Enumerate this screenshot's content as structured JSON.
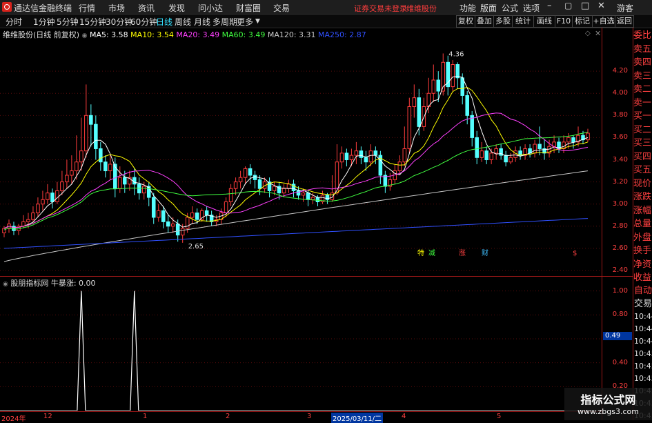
{
  "app": {
    "title": "通达信金融终端",
    "menu": [
      "行情",
      "市场",
      "资讯",
      "发现",
      "问小达",
      "财富圈",
      "交易"
    ],
    "status": "证券交易未登录",
    "stock": "维维股份",
    "right_menu": [
      "功能",
      "版面",
      "公式",
      "选项"
    ],
    "guest": "游客"
  },
  "toolbar": {
    "periods": [
      "分时",
      "1分钟",
      "5分钟",
      "15分钟",
      "30分钟",
      "60分钟",
      "日线",
      "周线",
      "月线",
      "多周期",
      "更多"
    ],
    "active": "日线",
    "buttons": [
      "复权",
      "叠加",
      "多股",
      "统计",
      "画线",
      "F10",
      "标记",
      "+自选",
      "返回"
    ]
  },
  "main_chart": {
    "name": "维维股份(日线 前复权)",
    "ma": [
      {
        "label": "MA5: 3.58",
        "color": "#ffffff"
      },
      {
        "label": "MA10: 3.54",
        "color": "#ffff00"
      },
      {
        "label": "MA20: 3.49",
        "color": "#ff40ff"
      },
      {
        "label": "MA60: 3.49",
        "color": "#40ff40"
      },
      {
        "label": "MA120: 3.31",
        "color": "#c8c8c8"
      },
      {
        "label": "MA250: 2.87",
        "color": "#3050ff"
      }
    ],
    "y_ticks": [
      "4.20",
      "4.00",
      "3.80",
      "3.60",
      "3.40",
      "3.20",
      "3.00",
      "2.80",
      "2.60",
      "2.40"
    ],
    "high_label": "4.36",
    "low_label": "2.65",
    "events": [
      {
        "text": "特",
        "color": "#ffff00"
      },
      {
        "text": "减",
        "color": "#40ff40"
      },
      {
        "text": "涨",
        "color": "#ff4040"
      },
      {
        "text": "财",
        "color": "#40c0ff"
      },
      {
        "text": "$",
        "color": "#ff4040"
      }
    ]
  },
  "sub_chart": {
    "name": "股朋指标网",
    "indicator": "牛暴涨: 0.00",
    "y_ticks": [
      "1.00",
      "0.80",
      "0.60",
      "0.40",
      "0.20"
    ],
    "current": "0.49"
  },
  "right_panel": {
    "labels": [
      "委比",
      "卖五",
      "卖四",
      "卖三",
      "卖二",
      "卖一",
      "买一",
      "买二",
      "买三",
      "买四",
      "买五",
      "现价",
      "涨跌",
      "涨幅",
      "总量",
      "外盘",
      "换手",
      "净资",
      "收益"
    ],
    "auto": "自动",
    "trade": "交易",
    "times": [
      "10:44",
      "10:44",
      "10:44",
      "10:45",
      "10:45",
      "10:45",
      "10:45",
      "10:45",
      "10:45"
    ]
  },
  "x_axis": [
    "2024年",
    "12",
    "1",
    "2",
    "3",
    "2025/03/11/二",
    "4",
    "5"
  ],
  "watermark": {
    "title": "指标公式网",
    "url": "www.zbgs3.com"
  },
  "chart_data": {
    "type": "candlestick",
    "title": "维维股份(日线 前复权)",
    "ylim": [
      2.35,
      4.5
    ],
    "candles": [
      [
        2.74,
        2.78,
        2.7,
        2.8
      ],
      [
        2.78,
        2.82,
        2.74,
        2.86
      ],
      [
        2.8,
        2.76,
        2.72,
        2.84
      ],
      [
        2.76,
        2.8,
        2.72,
        2.82
      ],
      [
        2.8,
        2.84,
        2.78,
        2.9
      ],
      [
        2.84,
        2.86,
        2.78,
        2.92
      ],
      [
        2.86,
        2.92,
        2.84,
        2.98
      ],
      [
        2.92,
        3.0,
        2.88,
        3.06
      ],
      [
        3.0,
        3.04,
        2.94,
        3.12
      ],
      [
        3.04,
        3.1,
        3.0,
        3.18
      ],
      [
        3.1,
        3.02,
        2.96,
        3.14
      ],
      [
        3.02,
        3.12,
        3.0,
        3.2
      ],
      [
        3.12,
        3.2,
        3.08,
        3.3
      ],
      [
        3.2,
        3.26,
        3.14,
        3.4
      ],
      [
        3.26,
        3.3,
        3.18,
        3.44
      ],
      [
        3.3,
        3.38,
        3.22,
        3.62
      ],
      [
        3.38,
        3.48,
        3.3,
        3.78
      ],
      [
        3.48,
        3.8,
        3.42,
        4.08
      ],
      [
        3.8,
        3.72,
        3.52,
        3.9
      ],
      [
        3.72,
        3.5,
        3.4,
        3.8
      ],
      [
        3.5,
        3.38,
        3.3,
        3.56
      ],
      [
        3.38,
        3.3,
        3.24,
        3.44
      ],
      [
        3.3,
        3.36,
        3.22,
        3.44
      ],
      [
        3.36,
        3.14,
        3.06,
        3.42
      ],
      [
        3.14,
        3.24,
        3.1,
        3.34
      ],
      [
        3.24,
        3.18,
        3.1,
        3.3
      ],
      [
        3.18,
        3.24,
        3.12,
        3.3
      ],
      [
        3.24,
        3.18,
        3.08,
        3.32
      ],
      [
        3.18,
        3.1,
        3.04,
        3.24
      ],
      [
        3.1,
        3.16,
        3.04,
        3.2
      ],
      [
        3.16,
        3.06,
        2.98,
        3.2
      ],
      [
        3.06,
        2.88,
        2.82,
        3.1
      ],
      [
        2.88,
        2.94,
        2.84,
        3.0
      ],
      [
        2.94,
        2.84,
        2.78,
        2.98
      ],
      [
        2.84,
        2.8,
        2.74,
        2.9
      ],
      [
        2.8,
        2.82,
        2.74,
        2.88
      ],
      [
        2.82,
        2.72,
        2.66,
        2.86
      ],
      [
        2.72,
        2.78,
        2.65,
        2.82
      ],
      [
        2.78,
        2.88,
        2.74,
        2.92
      ],
      [
        2.88,
        2.92,
        2.82,
        2.98
      ],
      [
        2.92,
        2.86,
        2.82,
        2.96
      ],
      [
        2.86,
        2.94,
        2.84,
        2.96
      ],
      [
        2.94,
        2.9,
        2.84,
        2.98
      ],
      [
        2.9,
        2.84,
        2.8,
        2.94
      ],
      [
        2.84,
        2.86,
        2.8,
        2.9
      ],
      [
        2.86,
        2.92,
        2.82,
        2.96
      ],
      [
        2.92,
        3.02,
        2.88,
        3.06
      ],
      [
        3.02,
        3.14,
        2.98,
        3.18
      ],
      [
        3.14,
        3.2,
        3.08,
        3.24
      ],
      [
        3.2,
        3.24,
        3.14,
        3.3
      ],
      [
        3.24,
        3.32,
        3.18,
        3.34
      ],
      [
        3.32,
        3.26,
        3.18,
        3.36
      ],
      [
        3.26,
        3.22,
        3.14,
        3.3
      ],
      [
        3.22,
        3.14,
        3.08,
        3.26
      ],
      [
        3.14,
        3.2,
        3.1,
        3.24
      ],
      [
        3.2,
        3.12,
        3.06,
        3.24
      ],
      [
        3.12,
        3.16,
        3.08,
        3.2
      ],
      [
        3.16,
        3.1,
        3.04,
        3.2
      ],
      [
        3.1,
        3.14,
        3.06,
        3.18
      ],
      [
        3.14,
        3.18,
        3.1,
        3.22
      ],
      [
        3.18,
        3.12,
        3.06,
        3.22
      ],
      [
        3.12,
        3.08,
        3.04,
        3.16
      ],
      [
        3.08,
        3.1,
        3.02,
        3.14
      ],
      [
        3.1,
        3.04,
        2.98,
        3.12
      ],
      [
        3.04,
        3.06,
        3.0,
        3.1
      ],
      [
        3.06,
        3.02,
        2.98,
        3.08
      ],
      [
        3.02,
        3.08,
        3.0,
        3.12
      ],
      [
        3.08,
        3.04,
        3.0,
        3.1
      ],
      [
        3.04,
        3.1,
        3.02,
        3.26
      ],
      [
        3.1,
        3.38,
        3.08,
        3.54
      ],
      [
        3.38,
        3.46,
        3.32,
        3.52
      ],
      [
        3.46,
        3.4,
        3.34,
        3.5
      ],
      [
        3.4,
        3.44,
        3.34,
        3.5
      ],
      [
        3.44,
        3.48,
        3.36,
        3.56
      ],
      [
        3.48,
        3.42,
        3.36,
        3.52
      ],
      [
        3.42,
        3.38,
        3.3,
        3.48
      ],
      [
        3.38,
        3.48,
        3.34,
        3.54
      ],
      [
        3.48,
        3.44,
        3.36,
        3.52
      ],
      [
        3.44,
        3.26,
        3.18,
        3.48
      ],
      [
        3.26,
        3.16,
        3.1,
        3.3
      ],
      [
        3.16,
        3.22,
        3.12,
        3.28
      ],
      [
        3.22,
        3.3,
        3.18,
        3.36
      ],
      [
        3.3,
        3.38,
        3.26,
        3.44
      ],
      [
        3.38,
        3.5,
        3.34,
        3.7
      ],
      [
        3.5,
        3.88,
        3.46,
        3.96
      ],
      [
        3.88,
        3.96,
        3.78,
        4.08
      ],
      [
        3.96,
        3.7,
        3.62,
        4.04
      ],
      [
        3.7,
        3.88,
        3.66,
        3.96
      ],
      [
        3.88,
        4.0,
        3.82,
        4.14
      ],
      [
        4.0,
        4.12,
        3.92,
        4.26
      ],
      [
        4.12,
        4.02,
        3.92,
        4.2
      ],
      [
        4.02,
        4.28,
        3.98,
        4.36
      ],
      [
        4.28,
        4.06,
        3.98,
        4.34
      ],
      [
        4.06,
        4.26,
        4.02,
        4.3
      ],
      [
        4.26,
        4.14,
        4.04,
        4.28
      ],
      [
        4.14,
        3.98,
        3.9,
        4.18
      ],
      [
        3.98,
        3.8,
        3.72,
        4.02
      ],
      [
        3.8,
        3.6,
        3.52,
        3.84
      ],
      [
        3.6,
        3.42,
        3.36,
        3.66
      ],
      [
        3.42,
        3.48,
        3.38,
        3.56
      ],
      [
        3.48,
        3.4,
        3.36,
        3.52
      ],
      [
        3.4,
        3.46,
        3.36,
        3.5
      ],
      [
        3.46,
        3.5,
        3.4,
        3.54
      ],
      [
        3.5,
        3.44,
        3.4,
        3.54
      ],
      [
        3.44,
        3.38,
        3.34,
        3.48
      ],
      [
        3.38,
        3.42,
        3.36,
        3.46
      ],
      [
        3.42,
        3.48,
        3.38,
        3.52
      ],
      [
        3.48,
        3.44,
        3.4,
        3.52
      ],
      [
        3.44,
        3.5,
        3.4,
        3.54
      ],
      [
        3.5,
        3.46,
        3.42,
        3.54
      ],
      [
        3.46,
        3.54,
        3.42,
        3.58
      ],
      [
        3.54,
        3.5,
        3.44,
        3.7
      ],
      [
        3.5,
        3.46,
        3.4,
        3.58
      ],
      [
        3.46,
        3.52,
        3.42,
        3.58
      ],
      [
        3.52,
        3.56,
        3.46,
        3.62
      ],
      [
        3.56,
        3.5,
        3.46,
        3.6
      ],
      [
        3.5,
        3.56,
        3.46,
        3.62
      ],
      [
        3.56,
        3.6,
        3.5,
        3.64
      ],
      [
        3.6,
        3.56,
        3.5,
        3.62
      ],
      [
        3.56,
        3.62,
        3.52,
        3.7
      ],
      [
        3.62,
        3.58,
        3.54,
        3.66
      ],
      [
        3.58,
        3.64,
        3.56,
        3.68
      ]
    ],
    "candle_fields": [
      "open",
      "close",
      "low",
      "high"
    ],
    "sub_series": {
      "name": "牛暴涨",
      "spikes_at": [
        16,
        27
      ],
      "values": [
        0,
        1,
        0,
        1,
        0
      ]
    }
  }
}
